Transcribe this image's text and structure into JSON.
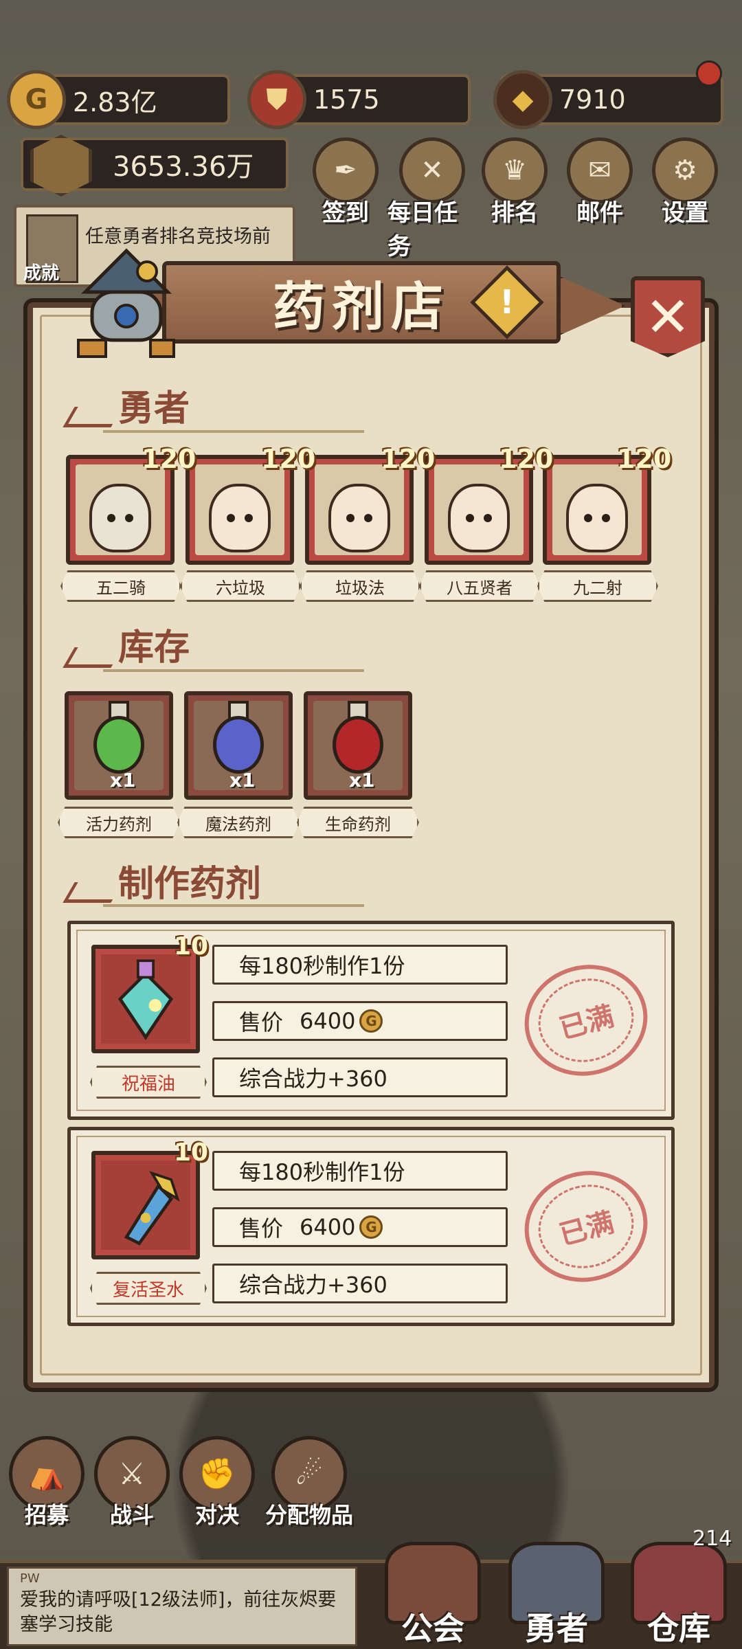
{
  "resources": {
    "gold": "2.83亿",
    "crest": "1575",
    "gem": "7910",
    "power": "3653.36万"
  },
  "top_nav": [
    {
      "label": "签到",
      "icon": "quill-icon"
    },
    {
      "label": "每日任务",
      "icon": "scroll-icon"
    },
    {
      "label": "排名",
      "icon": "crown-icon"
    },
    {
      "label": "邮件",
      "icon": "mail-icon"
    },
    {
      "label": "设置",
      "icon": "gear-icon"
    }
  ],
  "quest": {
    "text": "任意勇者排名竞技场前",
    "label": "成就"
  },
  "dialog": {
    "title": "药剂店",
    "alert": "!",
    "close": "✕"
  },
  "heroes_section": {
    "title": "勇者",
    "heroes": [
      {
        "name": "五二骑",
        "level": "120",
        "color": "#b94b44"
      },
      {
        "name": "六垃圾",
        "level": "120",
        "color": "#b94b44"
      },
      {
        "name": "垃圾法",
        "level": "120",
        "color": "#b94b44"
      },
      {
        "name": "八五贤者",
        "level": "120",
        "color": "#b94b44"
      },
      {
        "name": "九二射",
        "level": "120",
        "color": "#b94b44"
      }
    ]
  },
  "inventory_section": {
    "title": "库存",
    "items": [
      {
        "name": "活力药剂",
        "count": "x1",
        "color": "#5cb84a"
      },
      {
        "name": "魔法药剂",
        "count": "x1",
        "color": "#5a63c9"
      },
      {
        "name": "生命药剂",
        "count": "x1",
        "color": "#b3262a"
      }
    ]
  },
  "craft_section": {
    "title": "制作药剂",
    "recipes": [
      {
        "name": "祝福油",
        "level": "10",
        "rate": "每180秒制作1份",
        "price_label": "售价",
        "price": "6400",
        "power": "综合战力+360",
        "status": "已满"
      },
      {
        "name": "复活圣水",
        "level": "10",
        "rate": "每180秒制作1份",
        "price_label": "售价",
        "price": "6400",
        "power": "综合战力+360",
        "status": "已满"
      }
    ]
  },
  "actions": [
    {
      "label": "招募"
    },
    {
      "label": "战斗"
    },
    {
      "label": "对决"
    },
    {
      "label": "分配物品"
    }
  ],
  "chat": {
    "tag": "PW",
    "text": "爱我的请呼吸[12级法师]，前往灰烬要塞学习技能"
  },
  "tabs": [
    {
      "label": "公会"
    },
    {
      "label": "勇者"
    },
    {
      "label": "仓库"
    }
  ],
  "warehouse_count": "214",
  "coin_symbol": "G"
}
